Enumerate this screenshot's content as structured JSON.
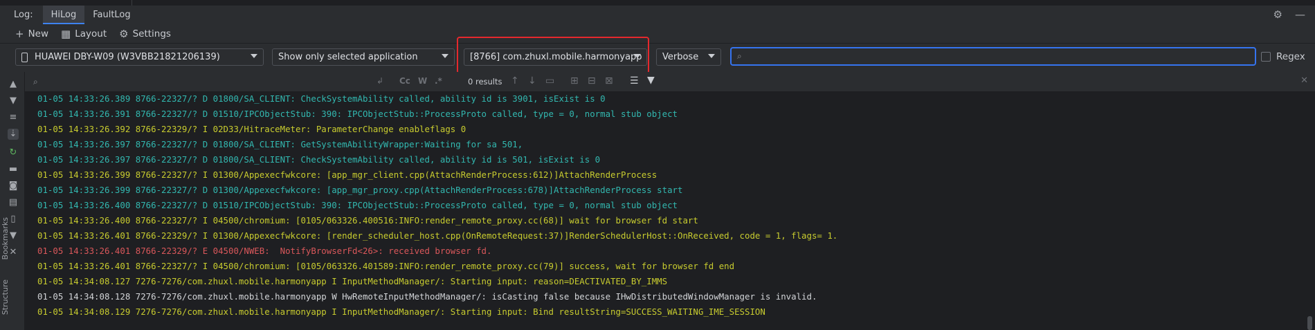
{
  "tabs": {
    "log_label": "Log:",
    "items": [
      {
        "label": "HiLog",
        "active": true
      },
      {
        "label": "FaultLog",
        "active": false
      }
    ]
  },
  "toolbar": {
    "new_label": "New",
    "layout_label": "Layout",
    "settings_label": "Settings"
  },
  "filters": {
    "device": "HUAWEI DBY-W09 (W3VBB21821206139)",
    "app_filter": "Show only selected application",
    "process": "[8766] com.zhuxl.mobile.harmonyapp",
    "level": "Verbose",
    "search_value": "",
    "regex_label": "Regex"
  },
  "log_search": {
    "query": "",
    "results_label": "0 results",
    "opt_case": "Cc",
    "opt_word": "W",
    "opt_regex": ".*"
  },
  "side_labels": {
    "bookmarks": "Bookmarks",
    "structure": "Structure"
  },
  "log_lines": [
    {
      "level": "D",
      "text": "01-05 14:33:26.389 8766-22327/? D 01800/SA_CLIENT: CheckSystemAbility called, ability id is 3901, isExist is 0"
    },
    {
      "level": "D",
      "text": "01-05 14:33:26.391 8766-22327/? D 01510/IPCObjectStub: 390: IPCObjectStub::ProcessProto called, type = 0, normal stub object"
    },
    {
      "level": "I",
      "text": "01-05 14:33:26.392 8766-22329/? I 02D33/HitraceMeter: ParameterChange enableflags 0"
    },
    {
      "level": "D",
      "text": "01-05 14:33:26.397 8766-22327/? D 01800/SA_CLIENT: GetSystemAbilityWrapper:Waiting for sa 501,"
    },
    {
      "level": "D",
      "text": "01-05 14:33:26.397 8766-22327/? D 01800/SA_CLIENT: CheckSystemAbility called, ability id is 501, isExist is 0"
    },
    {
      "level": "I",
      "text": "01-05 14:33:26.399 8766-22327/? I 01300/Appexecfwkcore: [app_mgr_client.cpp(AttachRenderProcess:612)]AttachRenderProcess"
    },
    {
      "level": "D",
      "text": "01-05 14:33:26.399 8766-22327/? D 01300/Appexecfwkcore: [app_mgr_proxy.cpp(AttachRenderProcess:678)]AttachRenderProcess start"
    },
    {
      "level": "D",
      "text": "01-05 14:33:26.400 8766-22327/? D 01510/IPCObjectStub: 390: IPCObjectStub::ProcessProto called, type = 0, normal stub object"
    },
    {
      "level": "I",
      "text": "01-05 14:33:26.400 8766-22327/? I 04500/chromium: [0105/063326.400516:INFO:render_remote_proxy.cc(68)] wait for browser fd start"
    },
    {
      "level": "I",
      "text": "01-05 14:33:26.401 8766-22329/? I 01300/Appexecfwkcore: [render_scheduler_host.cpp(OnRemoteRequest:37)]RenderSchedulerHost::OnReceived, code = 1, flags= 1."
    },
    {
      "level": "E",
      "text": "01-05 14:33:26.401 8766-22329/? E 04500/NWEB:  NotifyBrowserFd<26>: received browser fd."
    },
    {
      "level": "I",
      "text": "01-05 14:33:26.401 8766-22327/? I 04500/chromium: [0105/063326.401589:INFO:render_remote_proxy.cc(79)] success, wait for browser fd end"
    },
    {
      "level": "I",
      "text": "01-05 14:34:08.127 7276-7276/com.zhuxl.mobile.harmonyapp I InputMethodManager/: Starting input: reason=DEACTIVATED_BY_IMMS"
    },
    {
      "level": "W",
      "text": "01-05 14:34:08.128 7276-7276/com.zhuxl.mobile.harmonyapp W HwRemoteInputMethodManager/: isCasting false because IHwDistributedWindowManager is invalid."
    },
    {
      "level": "I",
      "text": "01-05 14:34:08.129 7276-7276/com.zhuxl.mobile.harmonyapp I InputMethodManager/: Starting input: Bind resultString=SUCCESS_WAITING_IME_SESSION"
    }
  ]
}
